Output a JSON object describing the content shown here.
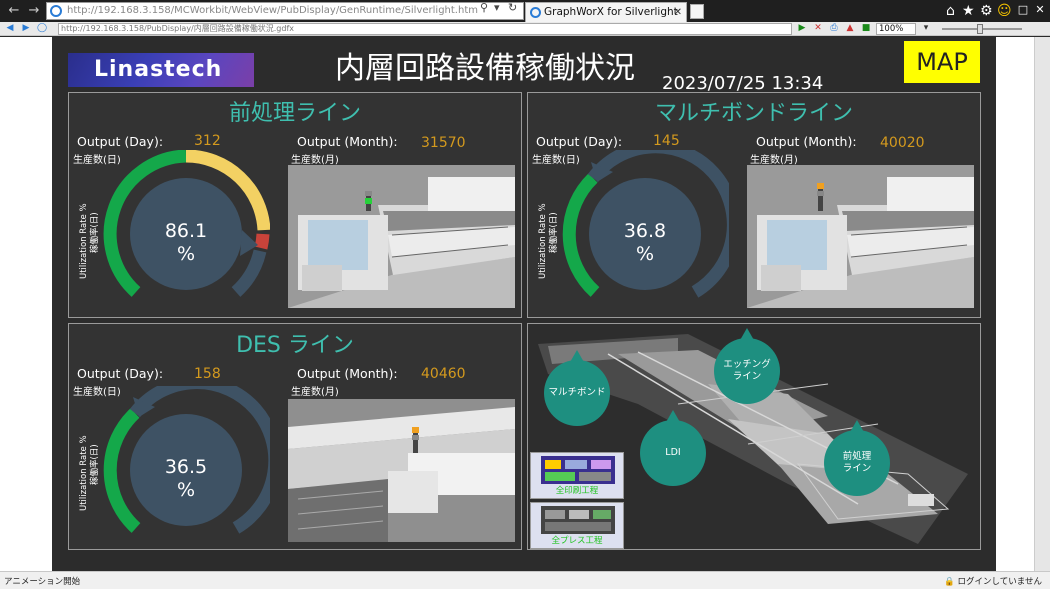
{
  "browser": {
    "address_url": "http://192.168.3.158/MCWorkbit/WebView/PubDisplay/GenRuntime/Silverlight.htm",
    "tab_title": "GraphWorX for Silverlight",
    "address2_url": "http://192.168.3.158/PubDisplay/内層回路設備稼働状況.gdfx",
    "zoom": "100%",
    "status_left": "アニメーション開始",
    "status_right": "ログインしていません"
  },
  "header": {
    "logo": "Linastech",
    "title": "内層回路設備稼働状況",
    "datetime": "2023/07/25 13:34",
    "map_button": "MAP"
  },
  "labels": {
    "output_day": "Output (Day):",
    "output_day_jp": "生産数(日)",
    "output_month": "Output (Month):",
    "output_month_jp": "生産数(月)",
    "util_rate": "Utilization Rate %",
    "util_rate_jp": "稼働率(日)"
  },
  "panels": [
    {
      "title": "前処理ライン",
      "output_day": "312",
      "output_month": "31570",
      "utilization": "86.1",
      "unit": "%"
    },
    {
      "title": "マルチボンドライン",
      "output_day": "145",
      "output_month": "40020",
      "utilization": "36.8",
      "unit": "%"
    },
    {
      "title": "DES ライン",
      "output_day": "158",
      "output_month": "40460",
      "utilization": "36.5",
      "unit": "%"
    }
  ],
  "map": {
    "bubbles": [
      "マルチボンド",
      "エッチング\nライン",
      "LDI",
      "前処理\nライン"
    ],
    "thumbnails": [
      "全印刷工程",
      "全プレス工程"
    ]
  },
  "colors": {
    "accent_title": "#3fbfaf",
    "value": "#d49a1e",
    "gauge_green": "#14a84a",
    "gauge_yellow": "#f3d163",
    "gauge_red": "#c8433a",
    "gauge_track": "#3e5264",
    "map_button": "#ffff00"
  }
}
